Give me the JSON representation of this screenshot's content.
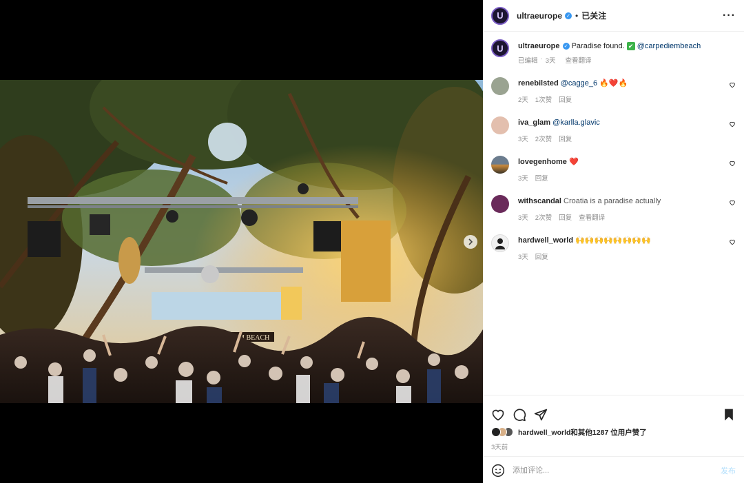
{
  "post": {
    "username": "ultraeurope",
    "verified": true,
    "follow_status": "已关注",
    "separator": "•",
    "more_label": "···",
    "caption": {
      "username": "ultraeurope",
      "text": "Paradise found.",
      "emoji": "✔",
      "mention": "@carpediembeach",
      "edited": "已编辑",
      "dot": "·",
      "age": "3天",
      "translate": "查看翻译"
    }
  },
  "comments": [
    {
      "username": "renebilsted",
      "mention": "@cagge_6",
      "text": "",
      "emoji": "🔥❤️🔥",
      "age": "2天",
      "likes": "1次赞",
      "reply": "回复",
      "translate": ""
    },
    {
      "username": "iva_glam",
      "mention": "@karlla.glavic",
      "text": "",
      "emoji": "",
      "age": "3天",
      "likes": "2次赞",
      "reply": "回复",
      "translate": ""
    },
    {
      "username": "lovegenhome",
      "mention": "",
      "text": "",
      "emoji": "❤️",
      "age": "3天",
      "likes": "",
      "reply": "回复",
      "translate": ""
    },
    {
      "username": "withscandal",
      "mention": "",
      "text": "Croatia is a paradise actually",
      "emoji": "",
      "age": "3天",
      "likes": "2次赞",
      "reply": "回复",
      "translate": "查看翻译"
    },
    {
      "username": "hardwell_world",
      "mention": "",
      "text": "",
      "emoji": "🙌🙌🙌🙌🙌🙌🙌🙌",
      "age": "3天",
      "likes": "",
      "reply": "回复",
      "translate": ""
    }
  ],
  "footer": {
    "likes_text": "hardwell_world和其他1287 位用户赞了",
    "time": "3天前",
    "comment_placeholder": "添加评论...",
    "post_label": "发布"
  },
  "image": {
    "sign_text": "CARPE DIEM BEACH",
    "carousel_dots": 3,
    "carousel_active": 1
  },
  "colors": {
    "link": "#00376b",
    "meta": "#8e8e8e",
    "verified": "#3897f0",
    "post_disabled": "#b2dffc"
  },
  "icons": {
    "like": "heart-icon",
    "comment": "comment-icon",
    "share": "share-icon",
    "save": "bookmark-icon",
    "next": "chevron-right-icon",
    "emoji": "emoji-icon",
    "more": "more-icon"
  }
}
